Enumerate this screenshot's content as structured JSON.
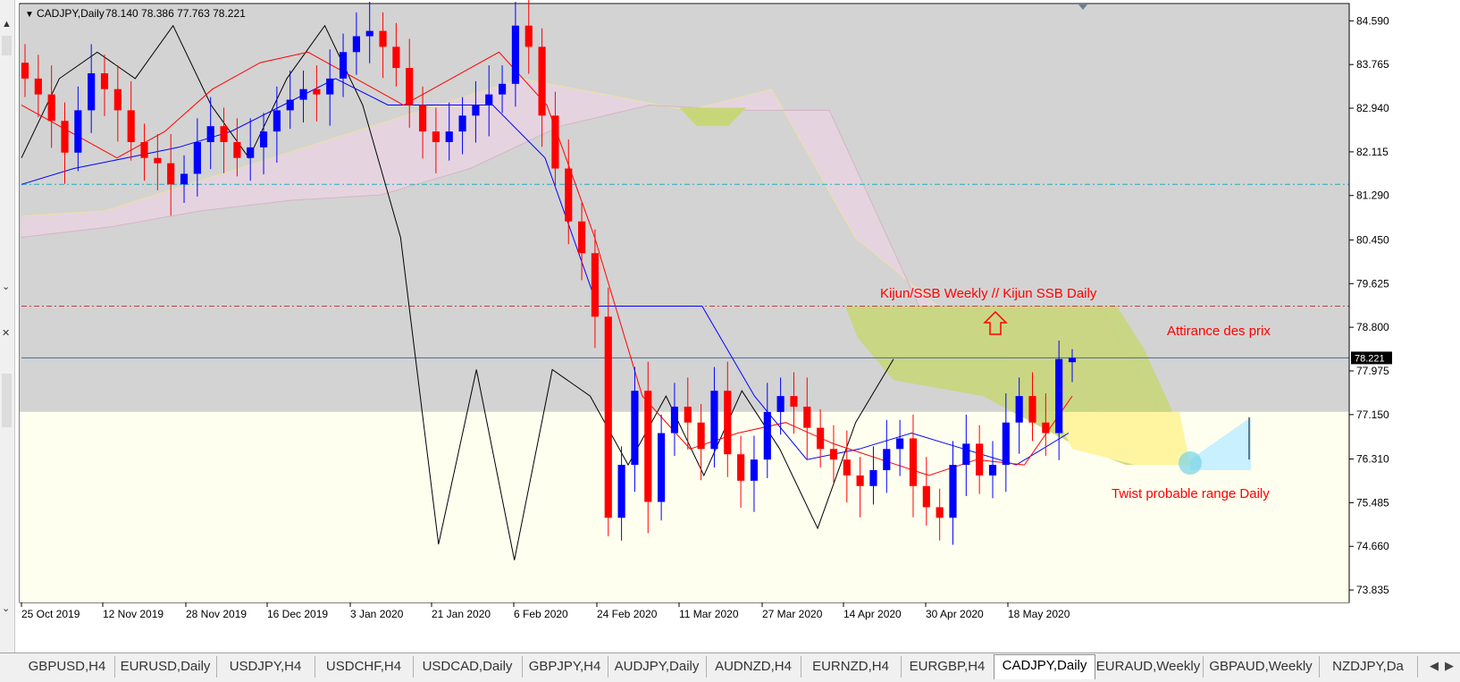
{
  "header": {
    "symbol": "CADJPY,Daily",
    "ohlc": "78.140 78.386 77.763 78.221",
    "dropdown_glyph": "▼"
  },
  "left_panel": {
    "up_icon": "▲",
    "close1": "✕",
    "down1": "⌄",
    "close2": "✕",
    "down2": "⌄"
  },
  "colors": {
    "chart_bg": "#d3d3d3",
    "lower_bg": "#fffff0",
    "bull": "#0000ff",
    "bear": "#ff0000",
    "tenkan": "#ff0000",
    "kijun": "#0000ff",
    "chikou": "#000000",
    "kumo_bear": "#e8d4e0",
    "kumo_bull": "#fff5a0",
    "highlight_zone": "#c8d67a",
    "twist_range": "#c8f0ff",
    "annotation": "#ff0000"
  },
  "price_axis": {
    "labels": [
      "84.590",
      "83.765",
      "82.940",
      "82.115",
      "81.290",
      "80.450",
      "79.625",
      "78.800",
      "77.975",
      "77.150",
      "76.310",
      "75.485",
      "74.660",
      "73.835"
    ],
    "current_price": "78.221"
  },
  "annotations": {
    "kijun_ssb": "Kijun/SSB Weekly // Kijun SSB Daily",
    "attirance": "Attirance des prix",
    "twist": "Twist probable range Daily"
  },
  "chart_data": {
    "type": "candlestick",
    "symbol": "CADJPY",
    "timeframe": "Daily",
    "ylim": [
      73.6,
      84.9
    ],
    "x_labels": [
      "25 Oct 2019",
      "12 Nov 2019",
      "28 Nov 2019",
      "16 Dec 2019",
      "3 Jan 2020",
      "21 Jan 2020",
      "6 Feb 2020",
      "24 Feb 2020",
      "11 Mar 2020",
      "27 Mar 2020",
      "14 Apr 2020",
      "30 Apr 2020",
      "18 May 2020"
    ],
    "last_ohlc": {
      "open": 78.14,
      "high": 78.386,
      "low": 77.763,
      "close": 78.221
    },
    "horizontal_lines": [
      {
        "name": "support",
        "value": 81.5,
        "style": "dash-dot",
        "color": "#20b0c0"
      },
      {
        "name": "kijun-ssb-weekly",
        "value": 79.2,
        "style": "dash-dot",
        "color": "#c04040"
      },
      {
        "name": "current-price",
        "value": 78.221,
        "style": "solid",
        "color": "#4a6a8a"
      }
    ],
    "shaded_bands": [
      {
        "name": "upper-range",
        "from": 77.2,
        "to": 84.9,
        "color": "#d3d3d3"
      },
      {
        "name": "lower-range",
        "from": 73.6,
        "to": 77.2,
        "color": "#fffff0"
      }
    ],
    "series": [
      {
        "name": "candles",
        "kind": "ohlc",
        "close": [
          83.5,
          83.2,
          82.7,
          82.1,
          82.9,
          83.6,
          83.3,
          82.9,
          82.3,
          82.0,
          81.9,
          81.5,
          81.7,
          82.3,
          82.6,
          82.3,
          82.0,
          82.2,
          82.5,
          82.9,
          83.1,
          83.3,
          83.2,
          83.5,
          84.0,
          84.3,
          84.4,
          84.1,
          83.7,
          83.0,
          82.5,
          82.3,
          82.5,
          82.8,
          83.0,
          83.2,
          83.4,
          84.5,
          84.1,
          82.8,
          81.8,
          80.8,
          80.2,
          79.0,
          75.2,
          76.2,
          77.6,
          75.5,
          76.8,
          77.3,
          77.0,
          76.5,
          77.6,
          76.4,
          75.9,
          76.3,
          77.2,
          77.5,
          77.3,
          76.9,
          76.5,
          76.3,
          76.0,
          75.8,
          76.1,
          76.5,
          76.7,
          75.8,
          75.4,
          75.2,
          76.2,
          76.6,
          76.0,
          76.2,
          77.0,
          77.5,
          77.0,
          76.8,
          78.2,
          78.221
        ],
        "trend": "declining from ~84.5 in Feb 2020 to ~74 in Mar 2020, recovering to ~78.2 in May 2020"
      },
      {
        "name": "tenkan-sen",
        "kind": "line",
        "color": "#ff0000",
        "approx": [
          83.0,
          82.5,
          82.0,
          82.5,
          83.3,
          83.8,
          84.0,
          83.5,
          83.0,
          83.5,
          84.0,
          83.0,
          80.5,
          77.5,
          76.5,
          76.8,
          77.0,
          76.6,
          76.3,
          76.0,
          76.3,
          76.2,
          77.5
        ]
      },
      {
        "name": "kijun-sen",
        "kind": "line",
        "color": "#0000ff",
        "approx": [
          81.5,
          81.8,
          82.0,
          82.2,
          82.5,
          83.0,
          83.5,
          83.0,
          83.0,
          83.0,
          82.0,
          79.2,
          79.2,
          79.2,
          77.5,
          76.3,
          76.5,
          76.8,
          76.5,
          76.2,
          76.8
        ]
      },
      {
        "name": "chikou-span",
        "kind": "line",
        "color": "#000000",
        "approx": [
          82.0,
          83.5,
          84.0,
          83.5,
          84.5,
          83.0,
          82.0,
          83.5,
          84.5,
          83.0,
          80.5,
          74.7,
          78.0,
          74.4,
          78.0,
          77.5,
          76.2,
          77.5,
          76.0,
          77.6,
          76.5,
          75.0,
          77.0,
          78.2
        ]
      },
      {
        "name": "kumo-senkou-a",
        "kind": "line",
        "approx": [
          80.9,
          81.0,
          81.5,
          82.0,
          82.5,
          83.0,
          83.5,
          83.2,
          82.9,
          83.3,
          80.5,
          79.2,
          78.0,
          77.1,
          76.3
        ]
      },
      {
        "name": "kumo-senkou-b",
        "kind": "line",
        "approx": [
          80.5,
          80.7,
          81.0,
          81.2,
          81.3,
          81.8,
          82.6,
          83.0,
          82.9,
          82.9,
          79.2,
          79.2,
          79.2,
          76.3
        ]
      }
    ]
  },
  "tabs": [
    {
      "label": "GBPUSD,H4"
    },
    {
      "label": "EURUSD,Daily"
    },
    {
      "label": "USDJPY,H4"
    },
    {
      "label": "USDCHF,H4"
    },
    {
      "label": "USDCAD,Daily"
    },
    {
      "label": "GBPJPY,H4"
    },
    {
      "label": "AUDJPY,Daily"
    },
    {
      "label": "AUDNZD,H4"
    },
    {
      "label": "EURNZD,H4"
    },
    {
      "label": "EURGBP,H4"
    },
    {
      "label": "CADJPY,Daily",
      "active": true
    },
    {
      "label": "EURAUD,Weekly"
    },
    {
      "label": "GBPAUD,Weekly"
    },
    {
      "label": "NZDJPY,Da"
    }
  ],
  "tab_scroll": {
    "left": "◀",
    "right": "▶"
  }
}
